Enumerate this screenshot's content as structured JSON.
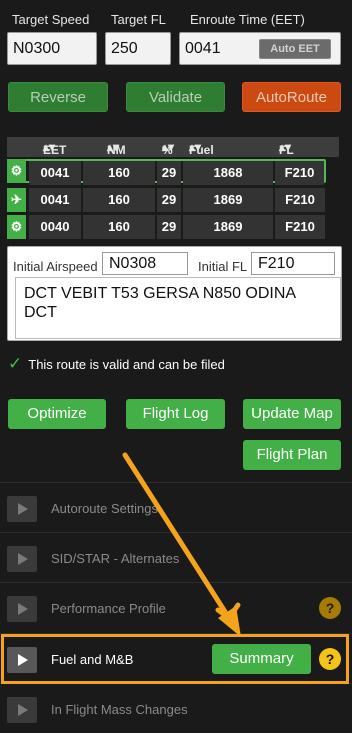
{
  "header": {
    "target_speed_label": "Target Speed",
    "target_fl_label": "Target FL",
    "enroute_time_label": "Enroute Time (EET)",
    "target_speed_value": "N0300",
    "target_fl_value": "250",
    "enroute_time_value": "0041",
    "auto_eet_label": "Auto EET"
  },
  "actions": {
    "reverse": "Reverse",
    "validate": "Validate",
    "autoroute": "AutoRoute"
  },
  "table": {
    "headers": [
      "EET",
      "NM",
      "%",
      "Fuel [lbs]",
      "FL"
    ],
    "rows": [
      {
        "icon": "gear-icon",
        "eet": "0041",
        "nm": "160",
        "pct": "29",
        "fuel": "1868",
        "fl": "F210"
      },
      {
        "icon": "plane-icon",
        "eet": "0041",
        "nm": "160",
        "pct": "29",
        "fuel": "1869",
        "fl": "F210"
      },
      {
        "icon": "gear-icon",
        "eet": "0040",
        "nm": "160",
        "pct": "29",
        "fuel": "1869",
        "fl": "F210"
      }
    ]
  },
  "plan": {
    "initial_airspeed_label": "Initial Airspeed",
    "initial_airspeed_value": "N0308",
    "initial_fl_label": "Initial FL",
    "initial_fl_value": "F210",
    "route": "DCT VEBIT T53 GERSA N850 ODINA DCT"
  },
  "status": {
    "message": "This route is valid and can be filed"
  },
  "tools": {
    "optimize": "Optimize",
    "flight_log": "Flight Log",
    "update_map": "Update Map",
    "flight_plan": "Flight Plan"
  },
  "sections": {
    "autoroute": "Autoroute Settings",
    "sid_star": "SID/STAR - Alternates",
    "performance": "Performance Profile",
    "fuel": "Fuel and M&B",
    "fuel_summary": "Summary",
    "mass_changes": "In Flight Mass Changes",
    "help_glyph": "?"
  },
  "colors": {
    "accent_green": "#43b047",
    "orange": "#cc4a12",
    "highlight": "#f5a31a",
    "help_yellow": "#f3c316"
  }
}
